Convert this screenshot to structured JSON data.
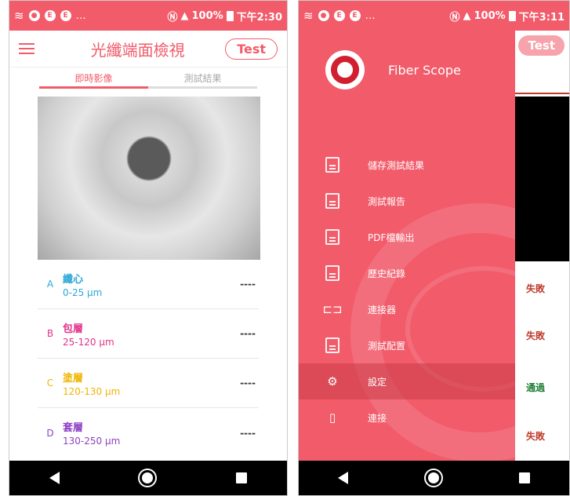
{
  "status_left": {
    "percent": "100%",
    "time": "下午2:30"
  },
  "status_right": {
    "percent": "100%",
    "time": "下午3:11"
  },
  "app": {
    "title": "光纖端面檢視",
    "test_label": "Test"
  },
  "tabs": [
    {
      "label": "即時影像",
      "active": true
    },
    {
      "label": "測試結果",
      "active": false
    }
  ],
  "zones": [
    {
      "letter": "A",
      "name": "纖心",
      "range": "0-25 μm",
      "result": "----",
      "color": "#2aa7d6"
    },
    {
      "letter": "B",
      "name": "包層",
      "range": "25-120 μm",
      "result": "----",
      "color": "#e0338a"
    },
    {
      "letter": "C",
      "name": "塗層",
      "range": "120-130 μm",
      "result": "----",
      "color": "#f0b400"
    },
    {
      "letter": "D",
      "name": "套層",
      "range": "130-250 μm",
      "result": "----",
      "color": "#8e3fc4"
    }
  ],
  "drawer": {
    "brand": "Fiber Scope",
    "items": [
      {
        "label": "儲存測試結果",
        "icon": "save-icon"
      },
      {
        "label": "測試報告",
        "icon": "report-icon"
      },
      {
        "label": "PDF檔輸出",
        "icon": "pdf-icon"
      },
      {
        "label": "歷史紀錄",
        "icon": "history-icon"
      },
      {
        "label": "連接器",
        "icon": "connector-icon"
      },
      {
        "label": "測試配置",
        "icon": "test-config-icon"
      },
      {
        "label": "設定",
        "icon": "settings-gear-icon",
        "selected": true
      },
      {
        "label": "連接",
        "icon": "phone-icon"
      }
    ]
  },
  "background_results": [
    {
      "label": "失敗",
      "status": "fail"
    },
    {
      "label": "失敗",
      "status": "fail"
    },
    {
      "label": "通過",
      "status": "pass"
    },
    {
      "label": "失敗",
      "status": "fail"
    }
  ]
}
